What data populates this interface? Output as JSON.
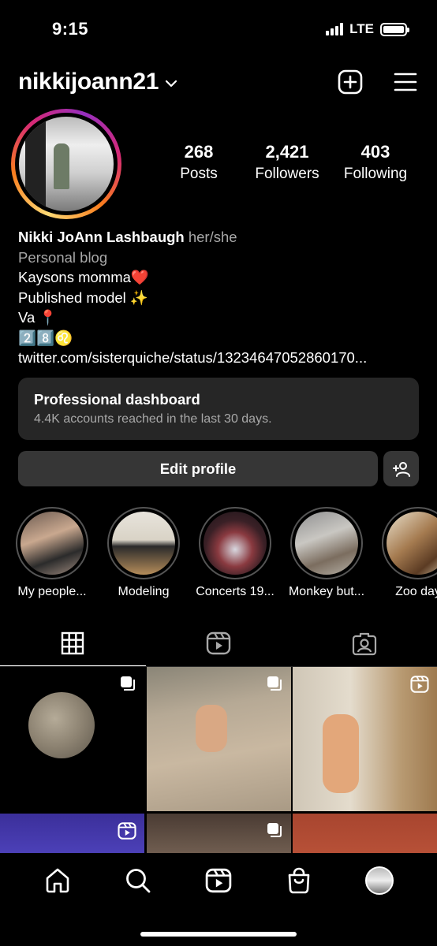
{
  "status_bar": {
    "time": "9:15",
    "network": "LTE"
  },
  "header": {
    "username": "nikkijoann21",
    "icons": [
      "chevron-down-icon",
      "new-post-icon",
      "menu-icon"
    ]
  },
  "stats": [
    {
      "value": "268",
      "label": "Posts"
    },
    {
      "value": "2,421",
      "label": "Followers"
    },
    {
      "value": "403",
      "label": "Following"
    }
  ],
  "bio": {
    "name": "Nikki JoAnn Lashbaugh",
    "pronouns": "her/she",
    "category": "Personal blog",
    "line1": "Kaysons momma❤️",
    "line2": "Published model ✨",
    "line3": "Va 📍",
    "line4": "2️⃣8️⃣♌",
    "link": "twitter.com/sisterquiche/status/13234647052860170..."
  },
  "dashboard": {
    "title": "Professional dashboard",
    "subtitle": "4.4K accounts reached in the last 30 days."
  },
  "buttons": {
    "edit_profile": "Edit profile"
  },
  "highlights": [
    {
      "label": "My people..."
    },
    {
      "label": "Modeling"
    },
    {
      "label": "Concerts 19..."
    },
    {
      "label": "Monkey but..."
    },
    {
      "label": "Zoo day"
    }
  ],
  "tabs": [
    "grid-icon",
    "reels-icon",
    "tagged-icon"
  ],
  "nav": [
    "home-icon",
    "search-icon",
    "reels-icon",
    "shop-icon",
    "profile-avatar"
  ],
  "colors": {
    "background": "#000000",
    "card": "#262626",
    "button": "#363636",
    "muted_text": "#a8a8a8"
  }
}
